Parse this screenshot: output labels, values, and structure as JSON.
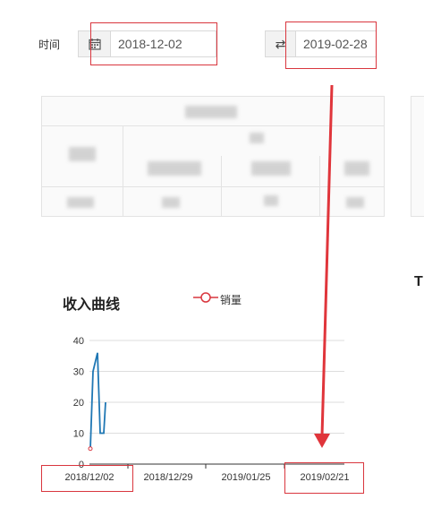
{
  "filter": {
    "label": "时间",
    "start_date": "2018-12-02",
    "swap_icon": "⇄",
    "end_date": "2019-02-28"
  },
  "chart": {
    "title": "收入曲线",
    "legend": "销量"
  },
  "right_partial": "T",
  "colors": {
    "series": "#1f77b4",
    "legend": "#d9363e",
    "annotation": "#d9363e"
  },
  "chart_data": {
    "type": "line",
    "title": "收入曲线",
    "series": [
      {
        "name": "销量",
        "values": [
          5,
          30,
          36,
          10,
          10,
          20
        ]
      }
    ],
    "ylim": [
      0,
      40
    ],
    "yticks": [
      "0",
      "10",
      "20",
      "30",
      "40"
    ],
    "xticks": [
      "2018/12/02",
      "2018/12/29",
      "2019/01/25",
      "2019/02/21"
    ],
    "grid": true,
    "legend_position": "top"
  }
}
